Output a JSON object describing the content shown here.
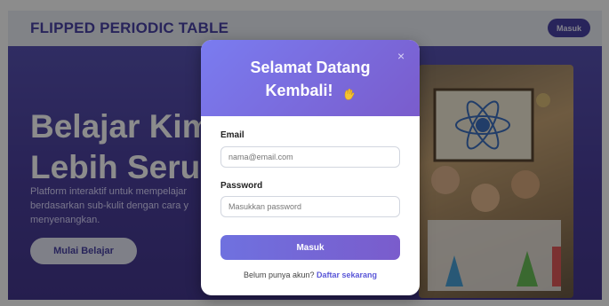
{
  "background": {
    "brand": "FLIPPED PERIODIC TABLE",
    "nav_login": "Masuk",
    "hero_title_line1": "Belajar Kimi",
    "hero_title_line2": "Lebih Seru!",
    "hero_desc": "Platform interaktif untuk mempelajar berdasarkan sub-kulit dengan cara y menyenangkan.",
    "hero_cta": "Mulai Belajar"
  },
  "modal": {
    "title_line1": "Selamat Datang",
    "title_line2": "Kembali!",
    "close_glyph": "×",
    "email_label": "Email",
    "email_placeholder": "nama@email.com",
    "password_label": "Password",
    "password_placeholder": "Masukkan password",
    "submit_label": "Masuk",
    "footer_text": "Belum punya akun?",
    "footer_link": "Daftar sekarang"
  },
  "colors": {
    "accent": "#7a5ccc",
    "link": "#5a57d8"
  },
  "icons": {
    "wave": "waving-hand-icon",
    "close": "close-icon"
  }
}
